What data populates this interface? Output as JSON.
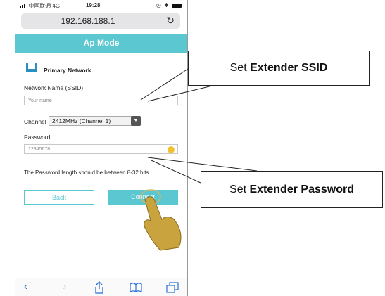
{
  "status_bar": {
    "carrier": "中国联通 4G",
    "time": "19:28"
  },
  "address_bar": {
    "url": "192.168.188.1"
  },
  "page": {
    "title": "Ap Mode",
    "section_title": "Primary Network",
    "ssid_label": "Network Name (SSID)",
    "ssid_placeholder": "Your name",
    "channel_label": "Channel",
    "channel_value": "2412MHz (Channel 1)",
    "password_label": "Password",
    "password_value": "12345678",
    "hint": "The Password length should be between 8-32 bits.",
    "back_button": "Back",
    "connect_button": "Connect"
  },
  "browser_toolbar": {
    "back": "‹",
    "forward": "›"
  },
  "callouts": {
    "ssid": {
      "prefix": "Set ",
      "bold": "Extender SSID"
    },
    "password": {
      "prefix": "Set ",
      "bold": "Extender Password"
    }
  }
}
